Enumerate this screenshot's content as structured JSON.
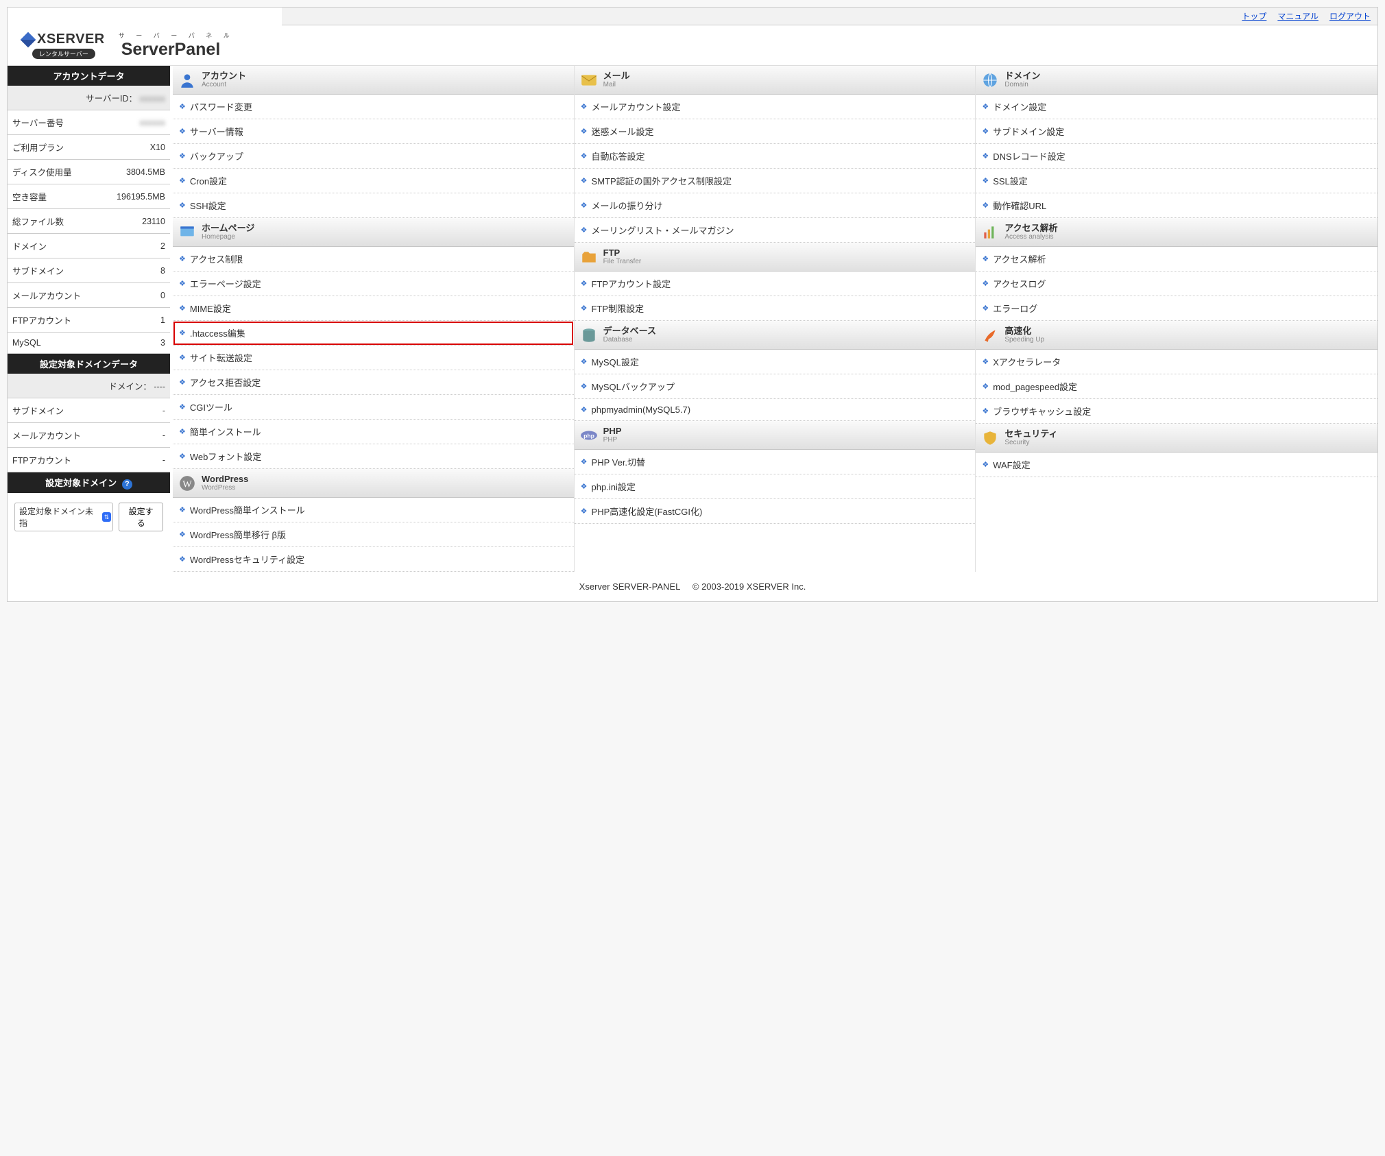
{
  "topLinks": {
    "top": "トップ",
    "manual": "マニュアル",
    "logout": "ログアウト"
  },
  "logo": {
    "brand": "XSERVER",
    "rental": "レンタルサーバー",
    "panelRuby": "サ ー バ ー パ ネ ル",
    "panel": "ServerPanel"
  },
  "sidebar": {
    "accountDataTitle": "アカウントデータ",
    "rows": [
      {
        "k": "サーバーID：",
        "v": "xxxxxx",
        "blur": true,
        "alt": true
      },
      {
        "k": "サーバー番号",
        "v": "xxxxxx",
        "blur": true
      },
      {
        "k": "ご利用プラン",
        "v": "X10"
      },
      {
        "k": "ディスク使用量",
        "v": "3804.5MB"
      },
      {
        "k": "空き容量",
        "v": "196195.5MB"
      },
      {
        "k": "総ファイル数",
        "v": "23110"
      },
      {
        "k": "ドメイン",
        "v": "2"
      },
      {
        "k": "サブドメイン",
        "v": "8"
      },
      {
        "k": "メールアカウント",
        "v": "0"
      },
      {
        "k": "FTPアカウント",
        "v": "1"
      },
      {
        "k": "MySQL",
        "v": "3"
      }
    ],
    "domainDataTitle": "設定対象ドメインデータ",
    "domainRows": [
      {
        "k": "ドメイン：",
        "v": "----",
        "alt": true
      },
      {
        "k": "サブドメイン",
        "v": "-"
      },
      {
        "k": "メールアカウント",
        "v": "-"
      },
      {
        "k": "FTPアカウント",
        "v": "-"
      }
    ],
    "targetDomainTitle": "設定対象ドメイン",
    "selectPlaceholder": "設定対象ドメイン未指",
    "setBtn": "設定する"
  },
  "cats": {
    "account": {
      "jp": "アカウント",
      "en": "Account",
      "items": [
        "パスワード変更",
        "サーバー情報",
        "バックアップ",
        "Cron設定",
        "SSH設定"
      ]
    },
    "mail": {
      "jp": "メール",
      "en": "Mail",
      "items": [
        "メールアカウント設定",
        "迷惑メール設定",
        "自動応答設定",
        "SMTP認証の国外アクセス制限設定",
        "メールの振り分け",
        "メーリングリスト・メールマガジン"
      ]
    },
    "domain": {
      "jp": "ドメイン",
      "en": "Domain",
      "items": [
        "ドメイン設定",
        "サブドメイン設定",
        "DNSレコード設定",
        "SSL設定",
        "動作確認URL"
      ]
    },
    "homepage": {
      "jp": "ホームページ",
      "en": "Homepage",
      "items": [
        "アクセス制限",
        "エラーページ設定",
        "MIME設定",
        ".htaccess編集",
        "サイト転送設定",
        "アクセス拒否設定",
        "CGIツール",
        "簡単インストール",
        "Webフォント設定"
      ]
    },
    "ftp": {
      "jp": "FTP",
      "en": "File Transfer",
      "items": [
        "FTPアカウント設定",
        "FTP制限設定"
      ]
    },
    "access": {
      "jp": "アクセス解析",
      "en": "Access analysis",
      "items": [
        "アクセス解析",
        "アクセスログ",
        "エラーログ"
      ]
    },
    "wordpress": {
      "jp": "WordPress",
      "en": "WordPress",
      "items": [
        "WordPress簡単インストール",
        "WordPress簡単移行 β版",
        "WordPressセキュリティ設定"
      ]
    },
    "database": {
      "jp": "データベース",
      "en": "Database",
      "items": [
        "MySQL設定",
        "MySQLバックアップ",
        "phpmyadmin(MySQL5.7)"
      ]
    },
    "speed": {
      "jp": "高速化",
      "en": "Speeding Up",
      "items": [
        "Xアクセラレータ",
        "mod_pagespeed設定",
        "ブラウザキャッシュ設定"
      ]
    },
    "php": {
      "jp": "PHP",
      "en": "PHP",
      "items": [
        "PHP Ver.切替",
        "php.ini設定",
        "PHP高速化設定(FastCGI化)"
      ]
    },
    "security": {
      "jp": "セキュリティ",
      "en": "Security",
      "items": [
        "WAF設定"
      ]
    }
  },
  "highlightItem": ".htaccess編集",
  "footer": {
    "a": "Xserver SERVER-PANEL",
    "b": "© 2003-2019 XSERVER Inc."
  }
}
